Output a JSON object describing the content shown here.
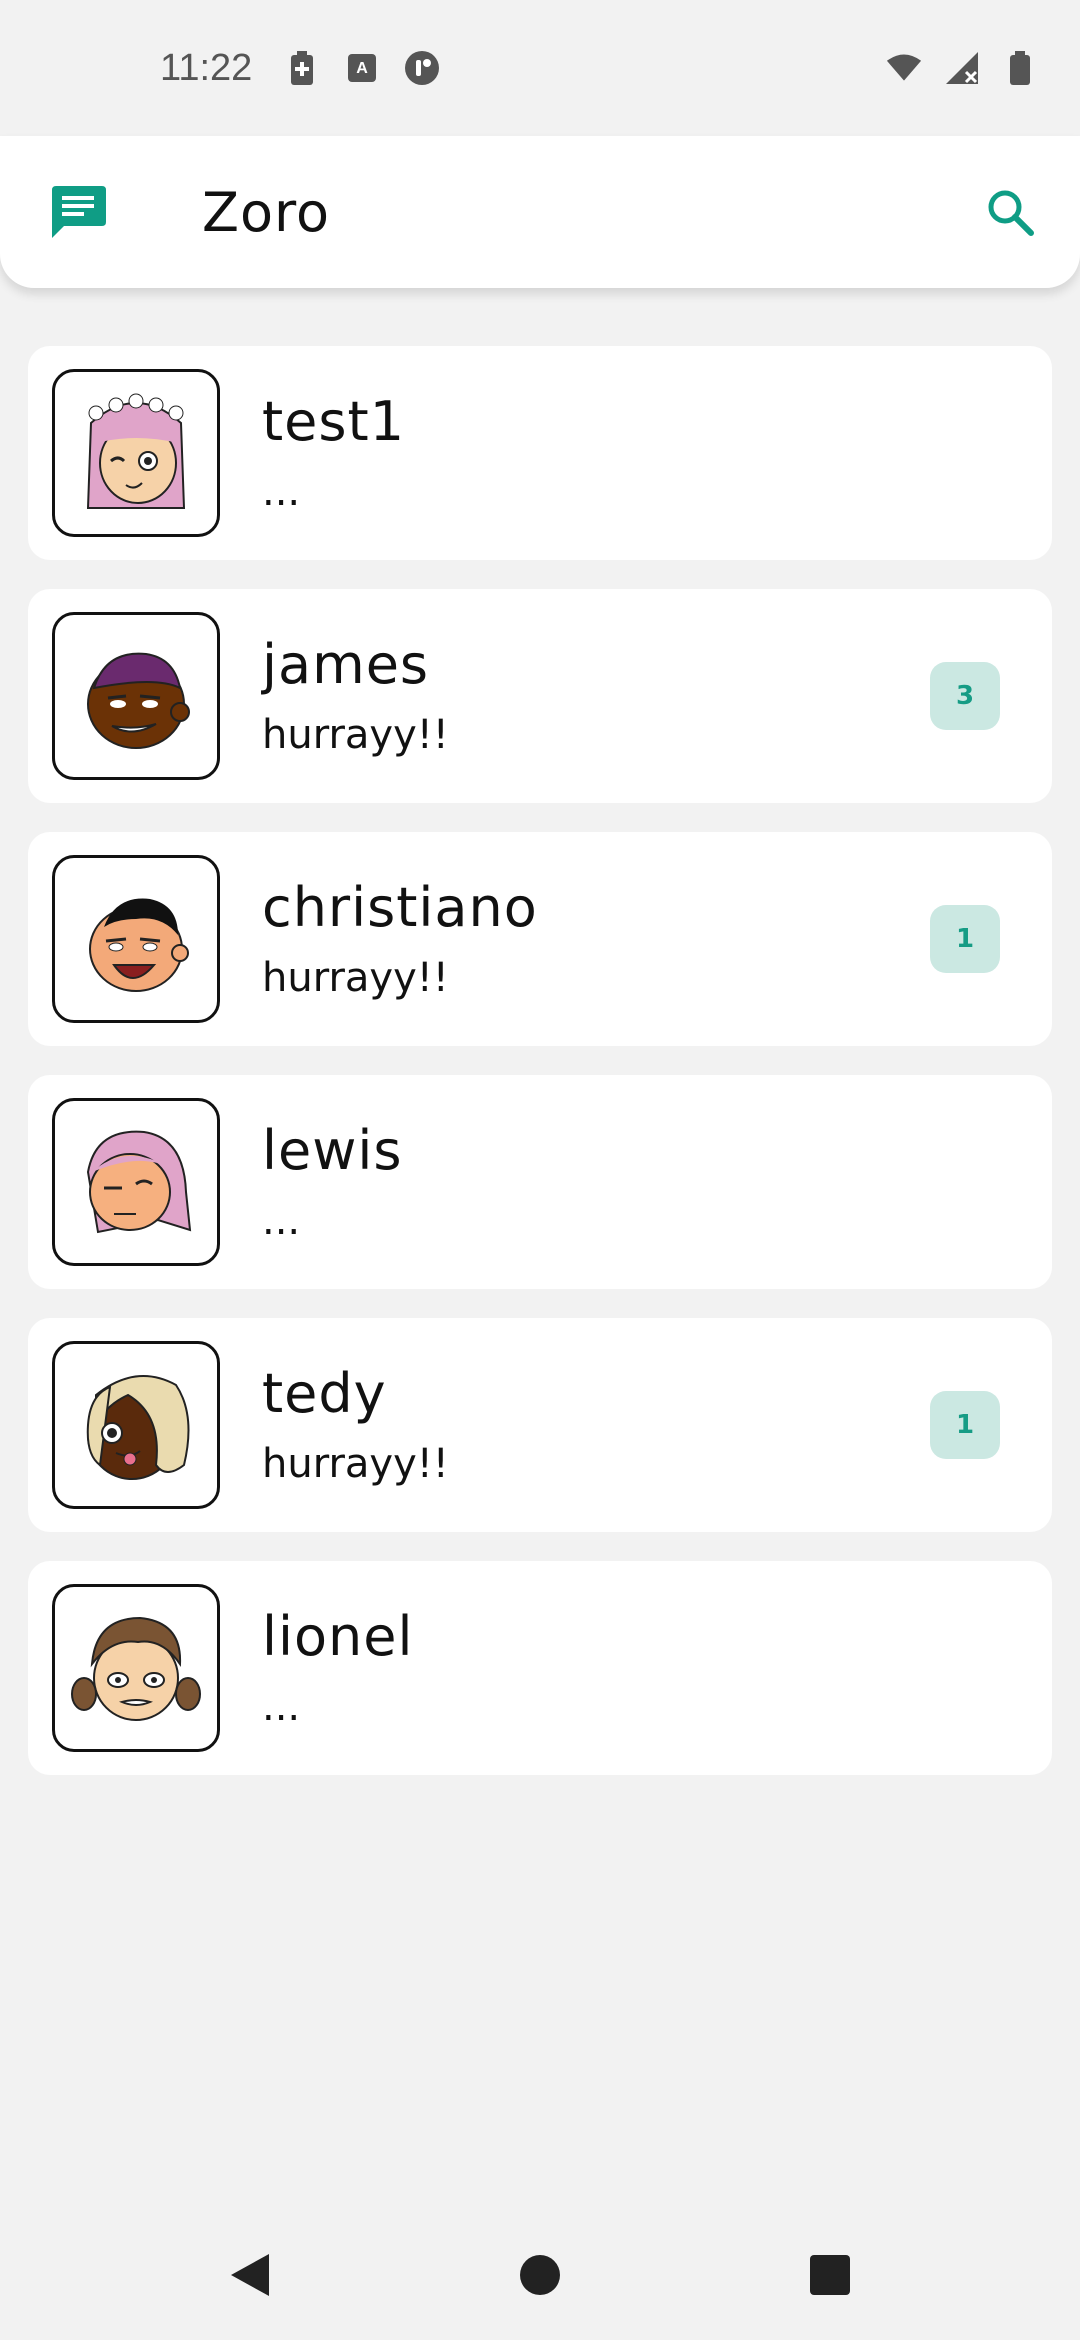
{
  "status_bar": {
    "time": "11:22"
  },
  "app_bar": {
    "title": "Zoro",
    "accent": "#0f9d85"
  },
  "chats": [
    {
      "name": "test1",
      "preview": "...",
      "unread": "",
      "avatar": "pink-hair-flower-crown-avatar"
    },
    {
      "name": "james",
      "preview": "hurrayy!!",
      "unread": "3",
      "avatar": "dark-skin-purple-cap-avatar"
    },
    {
      "name": "christiano",
      "preview": "hurrayy!!",
      "unread": "1",
      "avatar": "black-hair-smiling-avatar"
    },
    {
      "name": "lewis",
      "preview": "...",
      "unread": "",
      "avatar": "pink-bob-hair-avatar"
    },
    {
      "name": "tedy",
      "preview": "hurrayy!!",
      "unread": "1",
      "avatar": "blonde-hair-tongue-avatar"
    },
    {
      "name": "lionel",
      "preview": "...",
      "unread": "",
      "avatar": "brown-pigtails-avatar"
    }
  ],
  "colors": {
    "badge_bg": "#cbe8e2",
    "badge_text": "#169c85",
    "background": "#f2f2f2"
  }
}
